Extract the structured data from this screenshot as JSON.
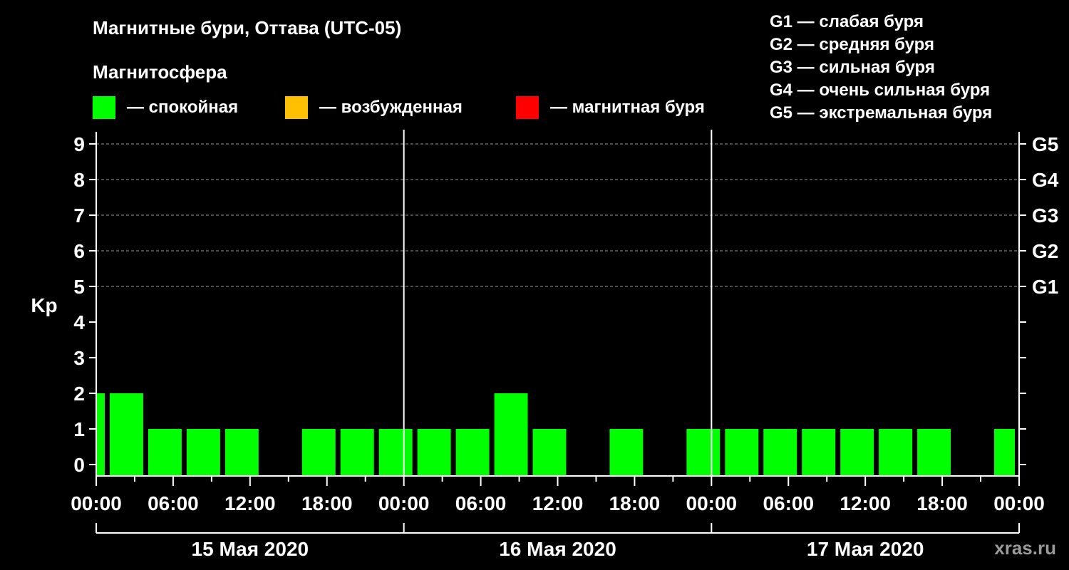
{
  "chart_data": {
    "type": "bar",
    "title": "Магнитные бури, Оттава (UTC-05)",
    "ylabel": "Kp",
    "ylim": [
      0,
      9
    ],
    "y_ticks": [
      0,
      1,
      2,
      3,
      4,
      5,
      6,
      7,
      8,
      9
    ],
    "storm_levels": [
      {
        "kp": 5,
        "label": "G1"
      },
      {
        "kp": 6,
        "label": "G2"
      },
      {
        "kp": 7,
        "label": "G3"
      },
      {
        "kp": 8,
        "label": "G4"
      },
      {
        "kp": 9,
        "label": "G5"
      }
    ],
    "storm_legend": [
      "G1 — слабая буря",
      "G2 — средняя буря",
      "G3 — сильная буря",
      "G4 — очень сильная буря",
      "G5 — экстремальная буря"
    ],
    "magnetosphere_title": "Магнитосфера",
    "magnetosphere_legend": [
      {
        "label": "— спокойная",
        "color": "#00ff00"
      },
      {
        "label": "— возбужденная",
        "color": "#ffc000"
      },
      {
        "label": "— магнитная буря",
        "color": "#ff0000"
      }
    ],
    "x_tick_labels": [
      "00:00",
      "06:00",
      "12:00",
      "18:00",
      "00:00",
      "06:00",
      "12:00",
      "18:00",
      "00:00",
      "06:00",
      "12:00",
      "18:00",
      "00:00"
    ],
    "days": [
      "15 Мая 2020",
      "16 Мая 2020",
      "17 Мая 2020"
    ],
    "bar_color": "#00ff00",
    "bars": [
      {
        "start": "2020-05-15 00:00",
        "end": "2020-05-15 01:00",
        "kp": 2
      },
      {
        "start": "2020-05-15 01:00",
        "end": "2020-05-15 04:00",
        "kp": 2
      },
      {
        "start": "2020-05-15 04:00",
        "end": "2020-05-15 07:00",
        "kp": 1
      },
      {
        "start": "2020-05-15 07:00",
        "end": "2020-05-15 10:00",
        "kp": 1
      },
      {
        "start": "2020-05-15 10:00",
        "end": "2020-05-15 13:00",
        "kp": 1
      },
      {
        "start": "2020-05-15 13:00",
        "end": "2020-05-15 16:00",
        "kp": 0
      },
      {
        "start": "2020-05-15 16:00",
        "end": "2020-05-15 19:00",
        "kp": 1
      },
      {
        "start": "2020-05-15 19:00",
        "end": "2020-05-15 22:00",
        "kp": 1
      },
      {
        "start": "2020-05-15 22:00",
        "end": "2020-05-16 01:00",
        "kp": 1
      },
      {
        "start": "2020-05-16 01:00",
        "end": "2020-05-16 04:00",
        "kp": 1
      },
      {
        "start": "2020-05-16 04:00",
        "end": "2020-05-16 07:00",
        "kp": 1
      },
      {
        "start": "2020-05-16 07:00",
        "end": "2020-05-16 10:00",
        "kp": 2
      },
      {
        "start": "2020-05-16 10:00",
        "end": "2020-05-16 13:00",
        "kp": 1
      },
      {
        "start": "2020-05-16 13:00",
        "end": "2020-05-16 16:00",
        "kp": 0
      },
      {
        "start": "2020-05-16 16:00",
        "end": "2020-05-16 19:00",
        "kp": 1
      },
      {
        "start": "2020-05-16 19:00",
        "end": "2020-05-16 22:00",
        "kp": 0
      },
      {
        "start": "2020-05-16 22:00",
        "end": "2020-05-17 01:00",
        "kp": 1
      },
      {
        "start": "2020-05-17 01:00",
        "end": "2020-05-17 04:00",
        "kp": 1
      },
      {
        "start": "2020-05-17 04:00",
        "end": "2020-05-17 07:00",
        "kp": 1
      },
      {
        "start": "2020-05-17 07:00",
        "end": "2020-05-17 10:00",
        "kp": 1
      },
      {
        "start": "2020-05-17 10:00",
        "end": "2020-05-17 13:00",
        "kp": 1
      },
      {
        "start": "2020-05-17 13:00",
        "end": "2020-05-17 16:00",
        "kp": 1
      },
      {
        "start": "2020-05-17 16:00",
        "end": "2020-05-17 19:00",
        "kp": 1
      },
      {
        "start": "2020-05-17 19:00",
        "end": "2020-05-17 22:00",
        "kp": 0
      },
      {
        "start": "2020-05-17 22:00",
        "end": "2020-05-18 00:00",
        "kp": 1
      }
    ],
    "grid": true,
    "watermark": "xras.ru"
  }
}
